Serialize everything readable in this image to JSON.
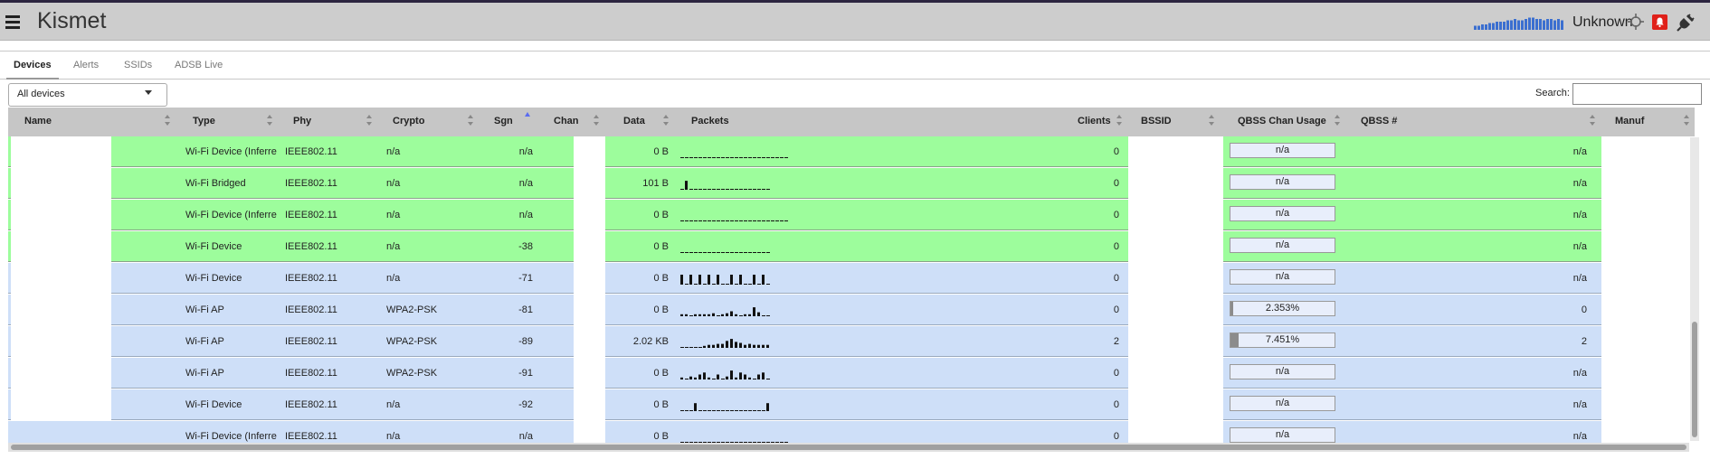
{
  "app": {
    "title": "Kismet",
    "status_label": "Unknown",
    "signal_history": [
      3,
      3,
      4,
      4,
      5,
      5,
      6,
      6,
      6,
      7,
      7,
      8,
      7,
      7,
      8,
      9,
      9,
      8,
      8,
      7,
      8,
      8,
      7,
      8,
      7
    ]
  },
  "tabs": [
    {
      "label": "Devices",
      "active": true
    },
    {
      "label": "Alerts",
      "active": false
    },
    {
      "label": "SSIDs",
      "active": false
    },
    {
      "label": "ADSB Live",
      "active": false
    }
  ],
  "filter": {
    "selected": "All devices"
  },
  "search": {
    "label": "Search:",
    "value": ""
  },
  "columns": {
    "name": "Name",
    "type": "Type",
    "phy": "Phy",
    "crypto": "Crypto",
    "sgn": "Sgn",
    "chan": "Chan",
    "data": "Data",
    "packets": "Packets",
    "clients": "Clients",
    "bssid": "BSSID",
    "qbss_chan_usage": "QBSS Chan Usage",
    "qbss_num": "QBSS #",
    "manuf": "Manuf"
  },
  "sort": {
    "column": "Sgn",
    "direction": "ascending"
  },
  "rows": [
    {
      "type": "Wi-Fi Device (Inferre",
      "phy": "IEEE802.11",
      "crypto": "n/a",
      "sgn": "n/a",
      "data": "0 B",
      "clients": "0",
      "qbss_usage": "n/a",
      "qbss_usage_pct": 0,
      "qbss_num": "n/a",
      "color": "green",
      "packets": [
        0,
        0,
        0,
        0,
        0,
        0,
        0,
        0,
        0,
        0,
        0,
        0,
        0,
        0,
        0,
        0,
        0,
        0,
        0,
        0,
        0,
        0,
        0,
        0
      ]
    },
    {
      "type": "Wi-Fi Bridged",
      "phy": "IEEE802.11",
      "crypto": "n/a",
      "sgn": "n/a",
      "data": "101 B",
      "clients": "0",
      "qbss_usage": "n/a",
      "qbss_usage_pct": 0,
      "qbss_num": "n/a",
      "color": "green",
      "packets": [
        0,
        9,
        0,
        0,
        0,
        0,
        0,
        0,
        0,
        0,
        0,
        0,
        0,
        0,
        0,
        0,
        0,
        0,
        0,
        0
      ]
    },
    {
      "type": "Wi-Fi Device (Inferre",
      "phy": "IEEE802.11",
      "crypto": "n/a",
      "sgn": "n/a",
      "data": "0 B",
      "clients": "0",
      "qbss_usage": "n/a",
      "qbss_usage_pct": 0,
      "qbss_num": "n/a",
      "color": "green",
      "packets": [
        0,
        0,
        0,
        0,
        0,
        0,
        0,
        0,
        0,
        0,
        0,
        0,
        0,
        0,
        0,
        0,
        0,
        0,
        0,
        0,
        0,
        0,
        0,
        0
      ]
    },
    {
      "type": "Wi-Fi Device",
      "phy": "IEEE802.11",
      "crypto": "n/a",
      "sgn": "-38",
      "data": "0 B",
      "clients": "0",
      "qbss_usage": "n/a",
      "qbss_usage_pct": 0,
      "qbss_num": "n/a",
      "color": "green",
      "packets": [
        0,
        0,
        0,
        0,
        0,
        0,
        0,
        0,
        0,
        0,
        0,
        0,
        0,
        0,
        0,
        0,
        0,
        0,
        0,
        0
      ]
    },
    {
      "type": "Wi-Fi Device",
      "phy": "IEEE802.11",
      "crypto": "n/a",
      "sgn": "-71",
      "data": "0 B",
      "clients": "0",
      "qbss_usage": "n/a",
      "qbss_usage_pct": 0,
      "qbss_num": "n/a",
      "color": "blue",
      "packets": [
        10,
        0,
        10,
        0,
        10,
        0,
        10,
        0,
        10,
        0,
        0,
        10,
        0,
        10,
        0,
        0,
        10,
        0,
        10,
        0
      ]
    },
    {
      "type": "Wi-Fi AP",
      "phy": "IEEE802.11",
      "crypto": "WPA2-PSK",
      "sgn": "-81",
      "data": "0 B",
      "clients": "0",
      "qbss_usage": "2.353%",
      "qbss_usage_pct": 2.353,
      "qbss_num": "0",
      "color": "blue",
      "packets": [
        2,
        2,
        0,
        2,
        2,
        2,
        2,
        3,
        0,
        2,
        3,
        5,
        2,
        0,
        2,
        2,
        9,
        4,
        0,
        0
      ]
    },
    {
      "type": "Wi-Fi AP",
      "phy": "IEEE802.11",
      "crypto": "WPA2-PSK",
      "sgn": "-89",
      "data": "2.02 KB",
      "clients": "2",
      "qbss_usage": "7.451%",
      "qbss_usage_pct": 7.451,
      "qbss_num": "2",
      "color": "blue",
      "packets": [
        0,
        0,
        0,
        0,
        0,
        2,
        3,
        3,
        4,
        4,
        7,
        9,
        6,
        5,
        3,
        4,
        3,
        3,
        3,
        3
      ]
    },
    {
      "type": "Wi-Fi AP",
      "phy": "IEEE802.11",
      "crypto": "WPA2-PSK",
      "sgn": "-91",
      "data": "0 B",
      "clients": "0",
      "qbss_usage": "n/a",
      "qbss_usage_pct": 0,
      "qbss_num": "n/a",
      "color": "blue",
      "packets": [
        2,
        0,
        3,
        2,
        5,
        7,
        2,
        0,
        5,
        0,
        3,
        9,
        2,
        7,
        5,
        2,
        0,
        5,
        7,
        0
      ]
    },
    {
      "type": "Wi-Fi Device",
      "phy": "IEEE802.11",
      "crypto": "n/a",
      "sgn": "-92",
      "data": "0 B",
      "clients": "0",
      "qbss_usage": "n/a",
      "qbss_usage_pct": 0,
      "qbss_num": "n/a",
      "color": "blue",
      "packets": [
        0,
        0,
        0,
        8,
        0,
        0,
        0,
        0,
        0,
        0,
        0,
        0,
        0,
        0,
        0,
        0,
        0,
        0,
        0,
        8
      ]
    },
    {
      "type": "Wi-Fi Device (Inferre",
      "phy": "IEEE802.11",
      "crypto": "n/a",
      "sgn": "n/a",
      "data": "0 B",
      "clients": "0",
      "qbss_usage": "n/a",
      "qbss_usage_pct": 0,
      "qbss_num": "n/a",
      "color": "blue",
      "packets": [
        0,
        0,
        0,
        0,
        0,
        0,
        0,
        0,
        0,
        0,
        0,
        0,
        0,
        0,
        0,
        0,
        0,
        0,
        0,
        0,
        0,
        0,
        0,
        0
      ]
    }
  ],
  "colors": {
    "topbar": "#cdcdcd",
    "signal_bars": "#3b6fd0",
    "row_green": "#9dfd9c",
    "row_blue": "#cedff8",
    "alert_bell": "#e0211a",
    "sort_arrow_active": "#5a6cf0"
  },
  "icons": {
    "menu": "hamburger-icon",
    "gps": "crosshair-icon",
    "alerts": "bell-icon",
    "connection": "plug-icon"
  }
}
